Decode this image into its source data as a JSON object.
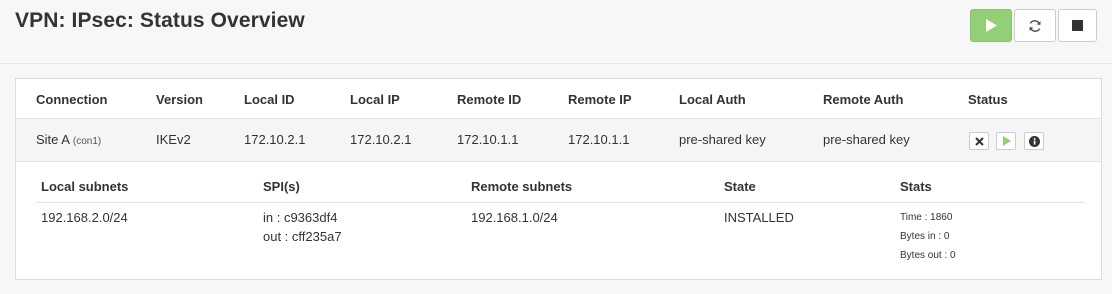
{
  "header": {
    "title": "VPN: IPsec: Status Overview",
    "buttons": [
      {
        "name": "start-button",
        "icon": "play-icon",
        "color": "#93cf77"
      },
      {
        "name": "restart-button",
        "icon": "refresh-icon"
      },
      {
        "name": "stop-button",
        "icon": "stop-icon"
      }
    ]
  },
  "table": {
    "columns": [
      "Connection",
      "Version",
      "Local ID",
      "Local IP",
      "Remote ID",
      "Remote IP",
      "Local Auth",
      "Remote Auth",
      "Status"
    ],
    "row": {
      "connection": "Site A",
      "connection_sub": "(con1)",
      "version": "IKEv2",
      "local_id": "172.10.2.1",
      "local_ip": "172.10.2.1",
      "remote_id": "172.10.1.1",
      "remote_ip": "172.10.1.1",
      "local_auth": "pre-shared key",
      "remote_auth": "pre-shared key",
      "status_icons": [
        "close-icon",
        "play-icon",
        "info-icon"
      ]
    }
  },
  "detail": {
    "columns": [
      "Local subnets",
      "SPI(s)",
      "Remote subnets",
      "State",
      "Stats"
    ],
    "local_subnets": "192.168.2.0/24",
    "spi_in": "in : c9363df4",
    "spi_out": "out : cff235a7",
    "remote_subnets": "192.168.1.0/24",
    "state": "INSTALLED",
    "stats": [
      "Time : 1860",
      "Bytes in : 0",
      "Bytes out : 0"
    ]
  }
}
